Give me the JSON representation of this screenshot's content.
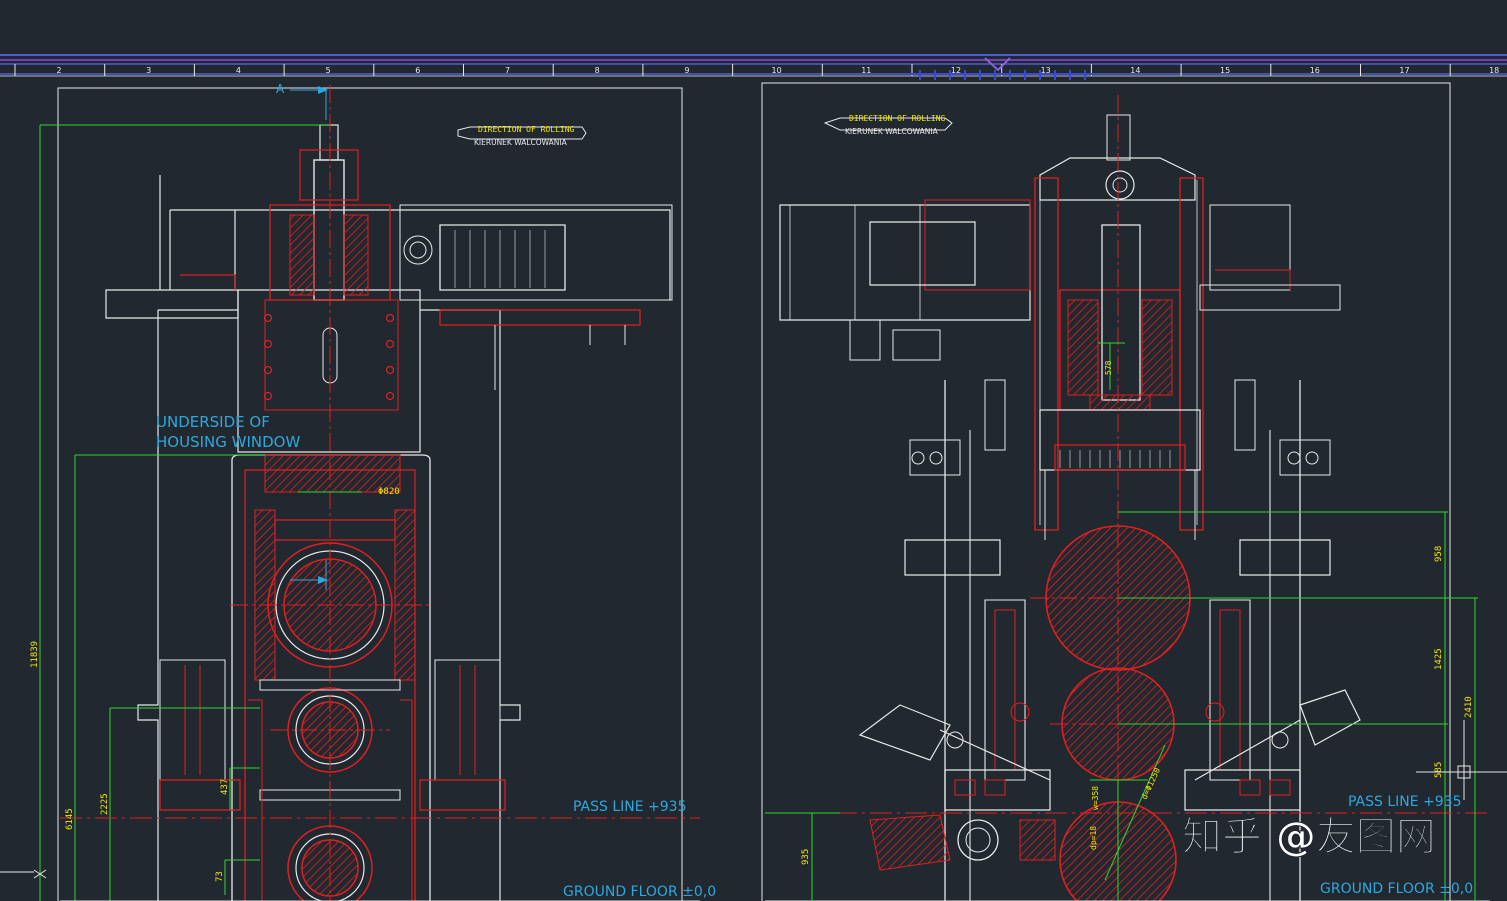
{
  "ruler": {
    "numbers": [
      "2",
      "3",
      "4",
      "5",
      "6",
      "7",
      "8",
      "9",
      "10",
      "11",
      "12",
      "13",
      "14",
      "15",
      "16",
      "17",
      "18"
    ]
  },
  "left_view": {
    "direction_label": "DIRECTION OF ROLLING",
    "direction_label_pl": "KIERUNEK WALCOWANIA",
    "section_marker": "A",
    "underside_line1": "UNDERSIDE OF",
    "underside_line2": "HOUSING WINDOW",
    "pass_line": "PASS LINE +935",
    "ground_floor": "GROUND FLOOR ±0,0",
    "dims": {
      "total_height": "11839",
      "d6145": "6145",
      "d2225": "2225",
      "d437": "437",
      "d73": "73",
      "phi820": "Φ820"
    }
  },
  "right_view": {
    "direction_label": "DIRECTION OF ROLLING",
    "direction_label_pl": "KIERUNEK WALCOWANIA",
    "pass_line": "PASS LINE +935",
    "ground_floor": "GROUND FLOOR ±0,0",
    "dims": {
      "d958": "958",
      "d1425": "1425",
      "d2410": "2410",
      "d585": "585",
      "d935": "935",
      "d578": "578",
      "w358": "w=358",
      "d1250": "d=Φ1250",
      "dp18": "dp=18"
    }
  },
  "watermark": "知乎 @友图网",
  "colors": {
    "background": "#212830",
    "outline": "#e8e8e8",
    "section": "#e02020",
    "dimension": "#2fd62f",
    "annotation": "#2ea8dc",
    "label": "#f2e600",
    "ruler": "#4a5fd0"
  }
}
